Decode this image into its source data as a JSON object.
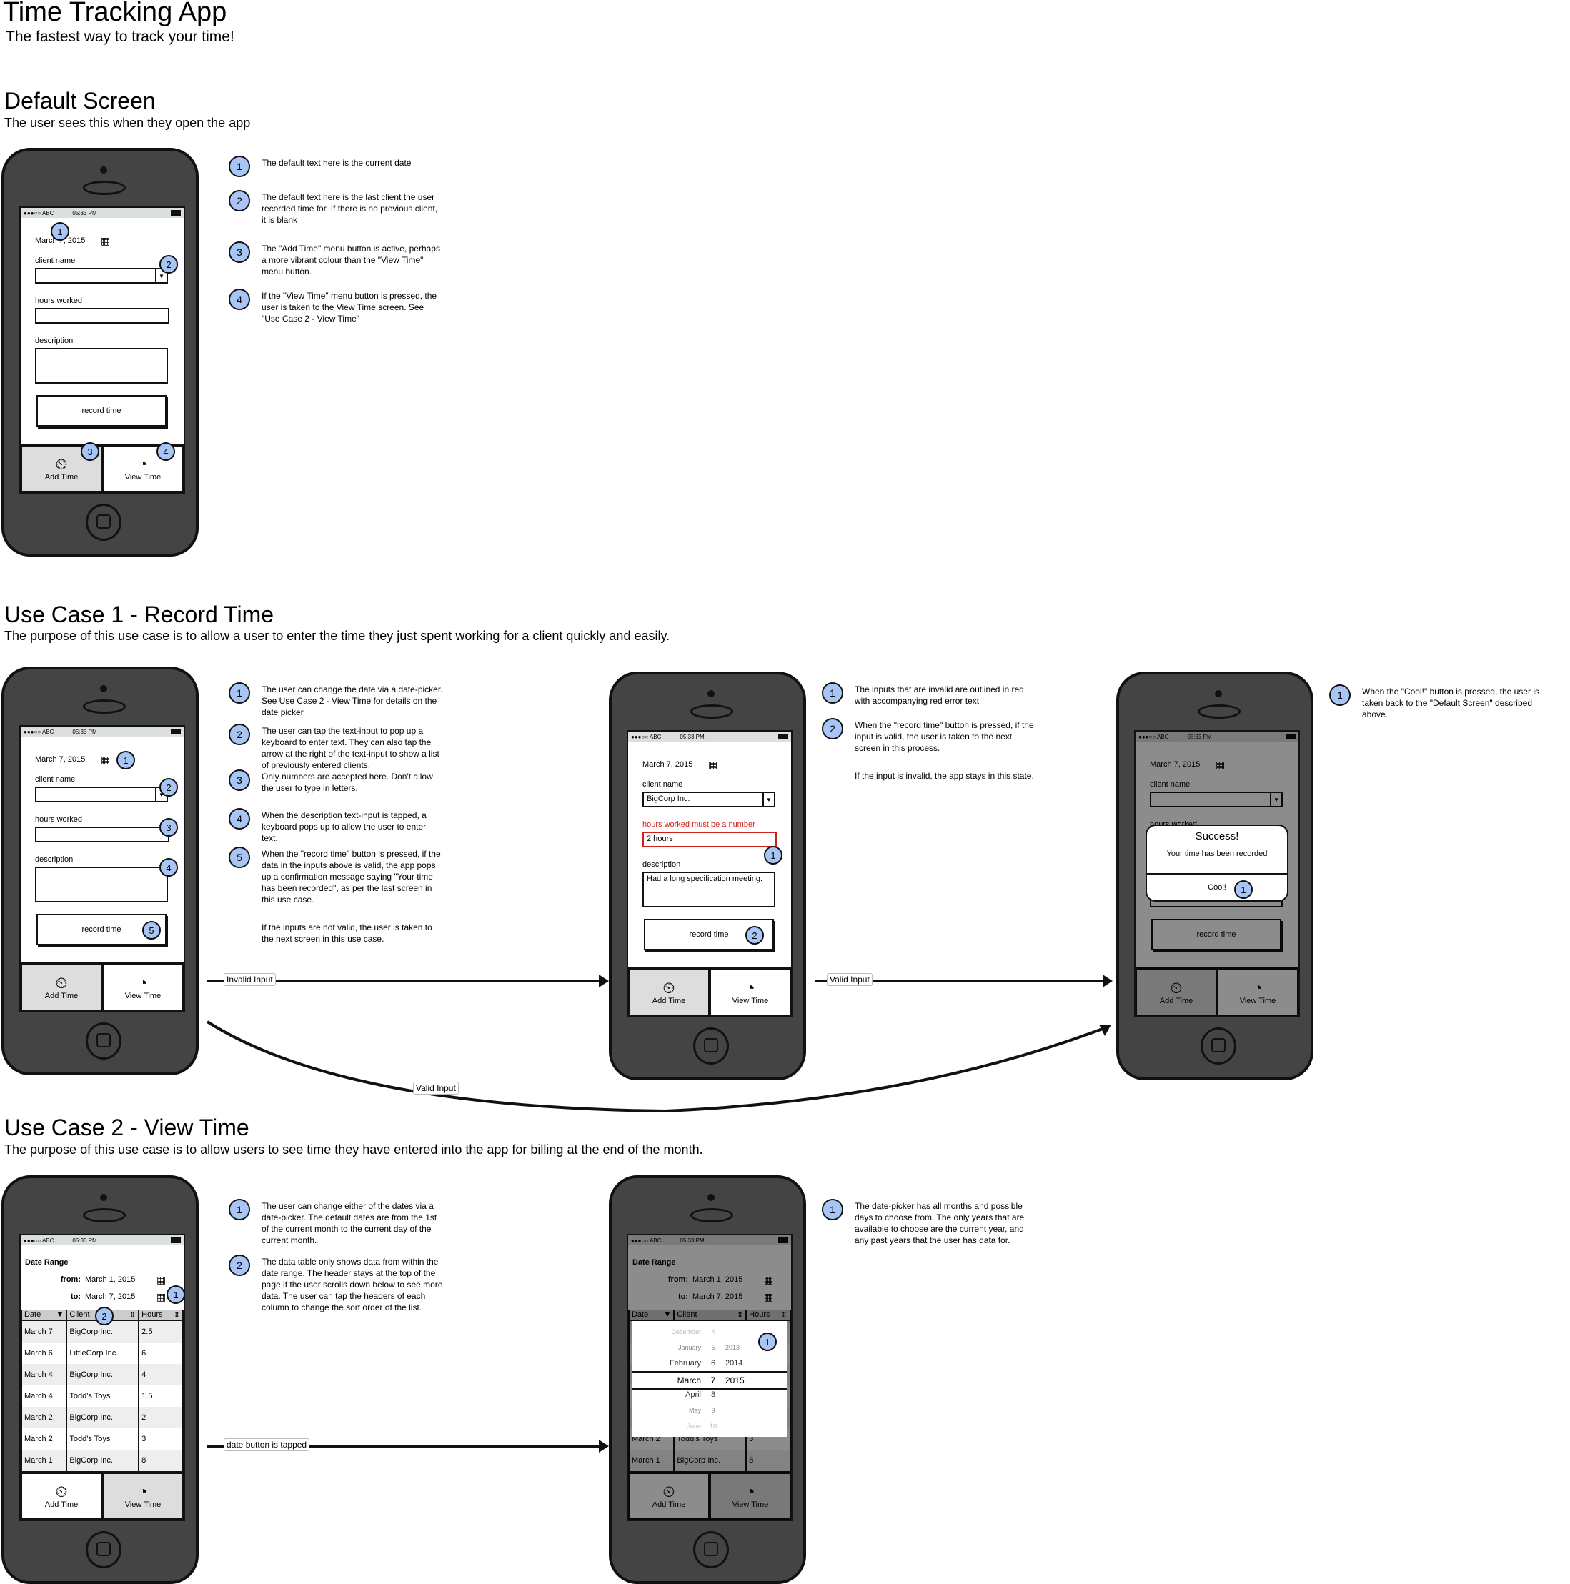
{
  "title": "Time Tracking App",
  "subtitle": "The fastest way to track your time!",
  "status_bar": {
    "carrier": "●●●○○ ABC",
    "time": "05:33 PM"
  },
  "tabs": {
    "add": "Add Time",
    "view": "View Time"
  },
  "form": {
    "date": "March 7, 2015",
    "client_label": "client name",
    "hours_label": "hours worked",
    "description_label": "description",
    "record_button": "record time"
  },
  "default_screen": {
    "heading": "Default Screen",
    "description": "The user sees this when they open the app",
    "notes": [
      {
        "n": "1",
        "text": "The default text here is the current date"
      },
      {
        "n": "2",
        "text": "The default text here is the last client the user recorded time for.  If there is no previous client, it is blank"
      },
      {
        "n": "3",
        "text": "The \"Add Time\" menu button is active, perhaps a more vibrant colour than the \"View Time\" menu button."
      },
      {
        "n": "4",
        "text": "If the \"View Time\" menu button is pressed, the user is taken to the View Time screen.  See \"Use Case 2 - View Time\""
      }
    ]
  },
  "use_case_1": {
    "heading": "Use Case 1 - Record Time",
    "description": "The purpose of this use case is to allow a user to enter the time they just spent working for a client quickly and easily.",
    "notes_a": [
      {
        "n": "1",
        "text": "The user can change the date via a date-picker.  See Use Case 2 - View Time for details on the date picker"
      },
      {
        "n": "2",
        "text": "The user can tap the text-input to pop up a keyboard to enter text.  They can also tap the arrow at the right of the text-input to show a list of previously entered clients."
      },
      {
        "n": "3",
        "text": "Only numbers are accepted here.  Don't allow the user to type in letters."
      },
      {
        "n": "4",
        "text": "When the description text-input is tapped, a keyboard pops up to allow the user to enter text."
      },
      {
        "n": "5",
        "text": "When the \"record time\" button is pressed, if the data in the inputs above is valid, the app pops up a confirmation message saying \"Your time has been recorded\", as per the last screen in this use case."
      }
    ],
    "notes_a_extra": "If the inputs are not valid, the user is taken to the next screen in this use case.",
    "invalid_screen": {
      "client_value": "BigCorp Inc.",
      "error_text": "hours worked must be a number",
      "hours_value": "2 hours",
      "description_value": "Had a long specification meeting."
    },
    "notes_b": [
      {
        "n": "1",
        "text": "The inputs that are invalid are outlined in red with accompanying red error text"
      },
      {
        "n": "2",
        "text": "When the \"record time\" button is pressed, if the input is valid, the user is taken to the next screen in this process."
      }
    ],
    "notes_b_extra": "If the input is invalid, the app stays in this state.",
    "success_dialog": {
      "title": "Success!",
      "message": "Your time has been recorded",
      "button": "Cool!"
    },
    "notes_c": [
      {
        "n": "1",
        "text": "When the \"Cool!\" button is pressed, the user is taken back to the \"Default Screen\" described above."
      }
    ],
    "edges": {
      "invalid": "Invalid Input",
      "valid": "Valid Input",
      "valid_curve": "Valid Input"
    }
  },
  "use_case_2": {
    "heading": "Use Case 2 - View Time",
    "description": "The purpose of this use case is to allow users to see time they have entered into the app for billing at the end of the month.",
    "date_range_label": "Date Range",
    "from_label": "from:",
    "from_value": "March 1, 2015",
    "to_label": "to:",
    "to_value": "March 7, 2015",
    "columns": [
      "Date",
      "Client",
      "Hours"
    ],
    "rows": [
      [
        "March 7",
        "BigCorp Inc.",
        "2.5"
      ],
      [
        "March 6",
        "LittleCorp Inc.",
        "6"
      ],
      [
        "March 4",
        "BigCorp Inc.",
        "4"
      ],
      [
        "March 4",
        "Todd's Toys",
        "1.5"
      ],
      [
        "March 2",
        "BigCorp Inc.",
        "2"
      ],
      [
        "March 2",
        "Todd's Toys",
        "3"
      ],
      [
        "March 1",
        "BigCorp Inc.",
        "8"
      ]
    ],
    "notes_a": [
      {
        "n": "1",
        "text": "The user can change either of the dates via a date-picker.  The default dates are from the 1st of the current month to the current day of the current month."
      },
      {
        "n": "2",
        "text": "The data table only shows data from within the date range.  The header stays at the top of the page if the user scrolls down below to see more data.  The user can tap the headers of each column to change the sort order of the list."
      }
    ],
    "picker": {
      "months": [
        "December",
        "January",
        "February",
        "March",
        "April",
        "May",
        "June"
      ],
      "days": [
        "4",
        "5",
        "6",
        "7",
        "8",
        "9",
        "10"
      ],
      "years": [
        "",
        "2013",
        "2014",
        "2015",
        "",
        "",
        ""
      ],
      "selected_index": 3
    },
    "notes_b": [
      {
        "n": "1",
        "text": "The date-picker has all months and possible days to choose from.  The only years that are available to choose are the current year, and any past years that the user has data for."
      }
    ],
    "edge": "date button is tapped"
  }
}
